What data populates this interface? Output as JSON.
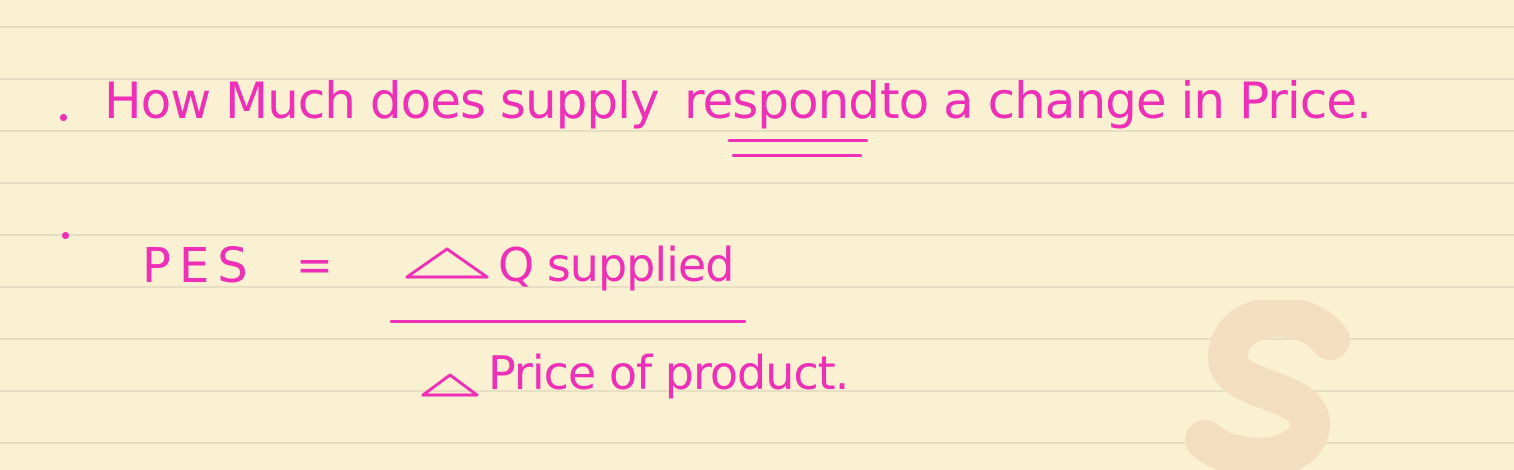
{
  "notes": {
    "line1": {
      "text_before": "How Much does supply",
      "emphasis": "respond",
      "text_after": "to a change in Price."
    },
    "line2": {
      "lhs": "PES",
      "equals": "=",
      "delta_symbol": "△",
      "numerator": "Q supplied",
      "denominator": "Price of product."
    }
  },
  "colors": {
    "ink": "#ee2fb8",
    "paper": "#f9f1d1",
    "rule": "#e6dfc4",
    "watermark": "#f3dfbf"
  }
}
